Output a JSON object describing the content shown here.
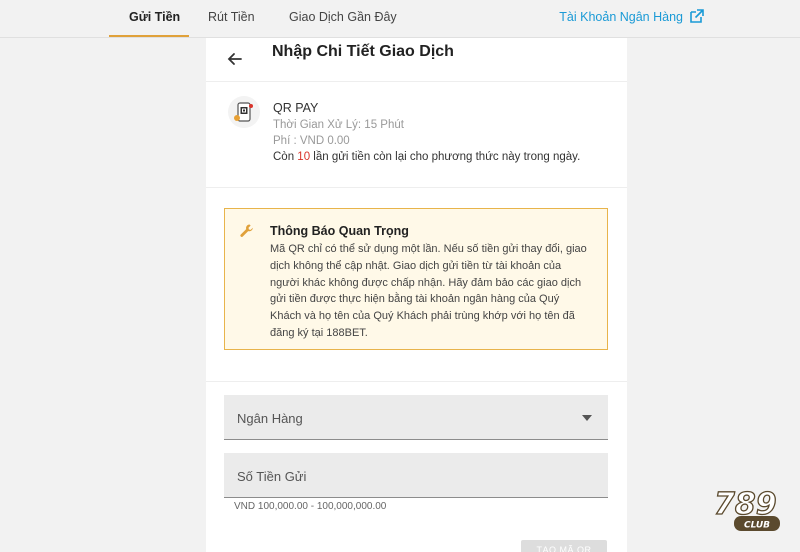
{
  "tabs": [
    {
      "label": "Gửi Tiền",
      "active": true
    },
    {
      "label": "Rút Tiền",
      "active": false
    },
    {
      "label": "Giao Dịch Gần Đây",
      "active": false
    }
  ],
  "bank_account_link": "Tài Khoản Ngân Hàng",
  "header": {
    "title": "Nhập Chi Tiết Giao Dịch"
  },
  "method": {
    "name": "QR PAY",
    "processing_time": "Thời Gian Xử Lý: 15 Phút",
    "fee": "Phí : VND 0.00",
    "remaining_prefix": "Còn ",
    "remaining_count": "10",
    "remaining_suffix": " lần gửi tiền còn lại cho phương thức này trong ngày."
  },
  "notice": {
    "title": "Thông Báo Quan Trọng",
    "body": "Mã QR chỉ có thể sử dụng một lần. Nếu số tiền gửi thay đổi, giao dịch không thể cập nhật. Giao dịch gửi tiền từ tài khoản của người khác không được chấp nhận. Hãy đảm bảo các giao dịch gửi tiền được thực hiện bằng tài khoản ngân hàng của Quý Khách và họ tên của Quý Khách phải trùng khớp với họ tên đã đăng ký tại 188BET."
  },
  "form": {
    "bank_label": "Ngân Hàng",
    "amount_label": "Số Tiền Gửi",
    "amount_hint": "VND 100,000.00 - 100,000,000.00",
    "submit_label": "TẠO MÃ QR"
  },
  "logo": {
    "text": "789",
    "sub": "CLUB"
  },
  "colors": {
    "accent": "#e0a13a",
    "link": "#1a9ad6",
    "notice_bg": "#fff9e8",
    "notice_border": "#e8b44b",
    "count_red": "#d9342b"
  }
}
